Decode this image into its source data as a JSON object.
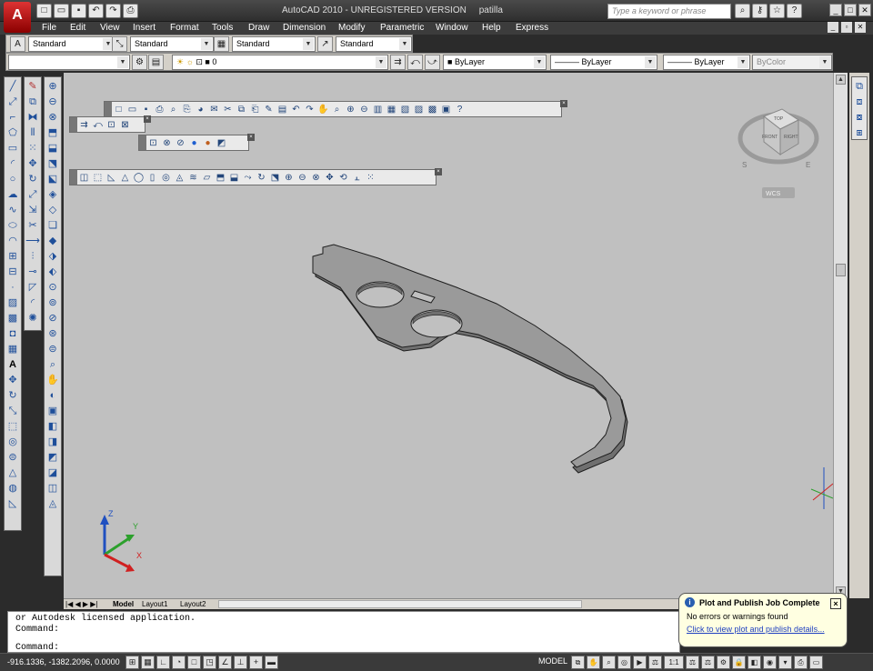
{
  "title_bar": {
    "app_title": "AutoCAD 2010 - UNREGISTERED VERSION",
    "drawing_name": "patilla",
    "search_placeholder": "Type a keyword or phrase",
    "app_button_icon": "autocad-logo-icon",
    "quick_access_icons": [
      "new-icon",
      "open-icon",
      "save-icon",
      "undo-icon",
      "redo-icon",
      "print-icon"
    ],
    "right_icons": [
      "binoculars-icon",
      "key-icon",
      "star-icon",
      "help-icon"
    ]
  },
  "menu": {
    "items": [
      "File",
      "Edit",
      "View",
      "Insert",
      "Format",
      "Tools",
      "Draw",
      "Dimension",
      "Modify",
      "Parametric",
      "Window",
      "Help",
      "Express"
    ]
  },
  "styles_toolbar": {
    "text_style": "Standard",
    "dim_style": "Standard",
    "table_style": "Standard",
    "multileader_style": "Standard"
  },
  "layers_toolbar": {
    "layer_state": "",
    "current_layer": "0",
    "color": "ByLayer",
    "linetype": "ByLayer",
    "lineweight": "ByLayer",
    "plotstyle": "ByColor"
  },
  "viewcube": {
    "top_label": "TOP",
    "front_label": "FRONT",
    "right_label": "RIGHT",
    "compass_s": "S",
    "compass_e": "E",
    "wcs_label": "WCS"
  },
  "ucs": {
    "x": "X",
    "y": "Y",
    "z": "Z"
  },
  "layout_tabs": [
    "Model",
    "Layout1",
    "Layout2"
  ],
  "command_line": {
    "lines": [
      "or Autodesk licensed application.",
      "Command:"
    ],
    "prompt": "Command:"
  },
  "status_bar": {
    "coordinates": "-916.1336, -1382.2096, 0.0000",
    "space": "MODEL",
    "scale": "1:1"
  },
  "notification": {
    "title": "Plot and Publish Job Complete",
    "message": "No errors or warnings found",
    "link": "Click to view plot and publish details..."
  },
  "colors": {
    "canvas_bg": "#c0c0c0",
    "part_top": "#9a9a9a",
    "part_side": "#6f6f6f",
    "ucs_x": "#d02020",
    "ucs_y": "#2ca02c",
    "ucs_z": "#2050c0"
  }
}
